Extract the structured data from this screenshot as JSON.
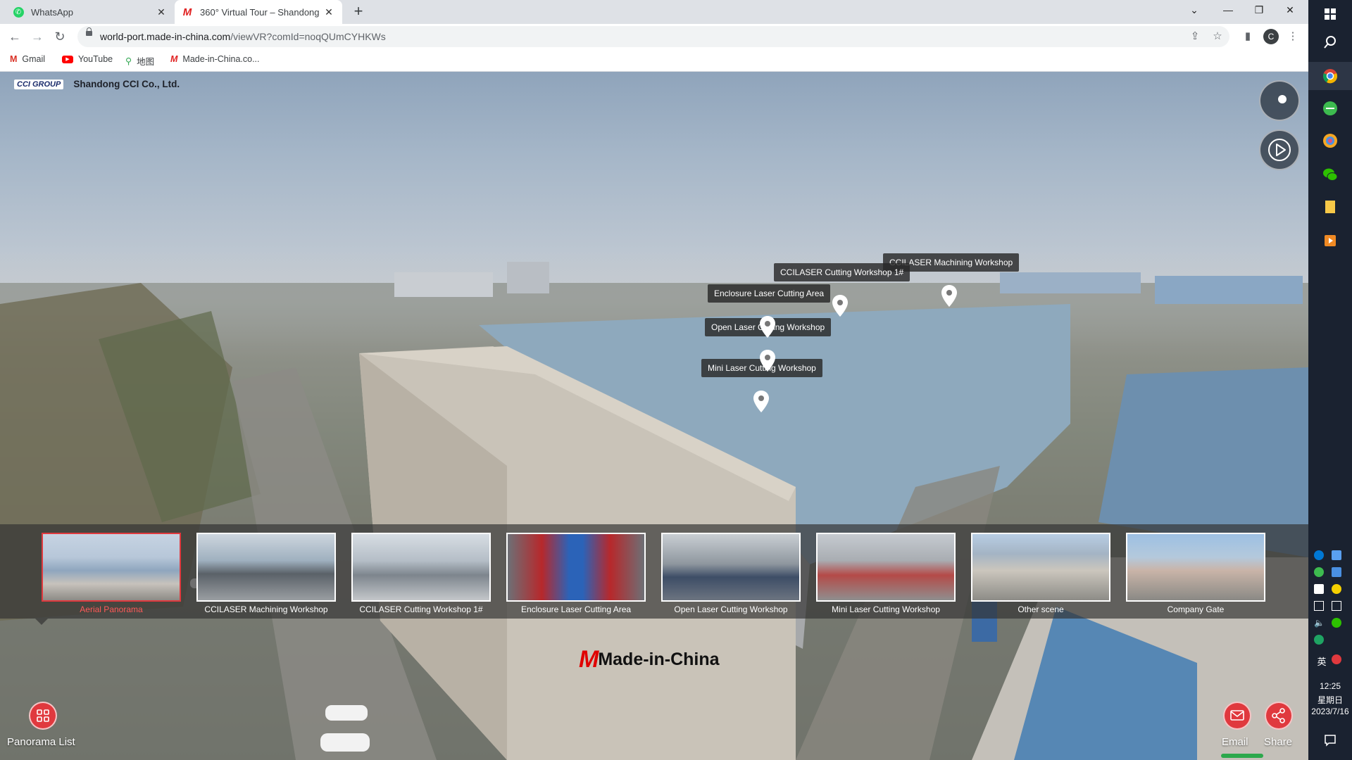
{
  "browser": {
    "tabs": [
      {
        "title": "WhatsApp",
        "active": false
      },
      {
        "title": "360° Virtual Tour – Shandong",
        "active": true
      }
    ],
    "url_host": "world-port.made-in-china.com",
    "url_path": "/viewVR?comId=noqQUmCYHKWs",
    "profile_initial": "C",
    "bookmarks": [
      {
        "label": "Gmail"
      },
      {
        "label": "YouTube"
      },
      {
        "label": "地图"
      },
      {
        "label": "Made-in-China.co..."
      }
    ]
  },
  "tour": {
    "brand_logo": "CCI GROUP",
    "company": "Shandong CCI Co., Ltd.",
    "hotspots": [
      {
        "label": "CCILASER Machining Workshop"
      },
      {
        "label": "CCILASER Cutting Workshop 1#"
      },
      {
        "label": "Enclosure Laser Cutting Area"
      },
      {
        "label": "Open Laser Cutting Workshop"
      },
      {
        "label": "Mini Laser Cutting Workshop"
      }
    ],
    "scenes": [
      {
        "label": "Aerial Panorama",
        "selected": true
      },
      {
        "label": "CCILASER Machining Workshop",
        "selected": false
      },
      {
        "label": "CCILASER Cutting Workshop 1#",
        "selected": false
      },
      {
        "label": "Enclosure Laser Cutting Area",
        "selected": false
      },
      {
        "label": "Open Laser Cutting Workshop",
        "selected": false
      },
      {
        "label": "Mini Laser Cutting Workshop",
        "selected": false
      },
      {
        "label": "Other scene",
        "selected": false
      },
      {
        "label": "Company Gate",
        "selected": false
      }
    ],
    "panorama_list_label": "Panorama List",
    "email_label": "Email",
    "share_label": "Share",
    "footer_logo": "Made-in-China"
  },
  "taskbar": {
    "time": "12:25",
    "weekday": "星期日",
    "date": "2023/7/16",
    "ime": "英"
  },
  "colors": {
    "accent_red": "#e0393e",
    "taskbar_bg": "#1a2230"
  }
}
